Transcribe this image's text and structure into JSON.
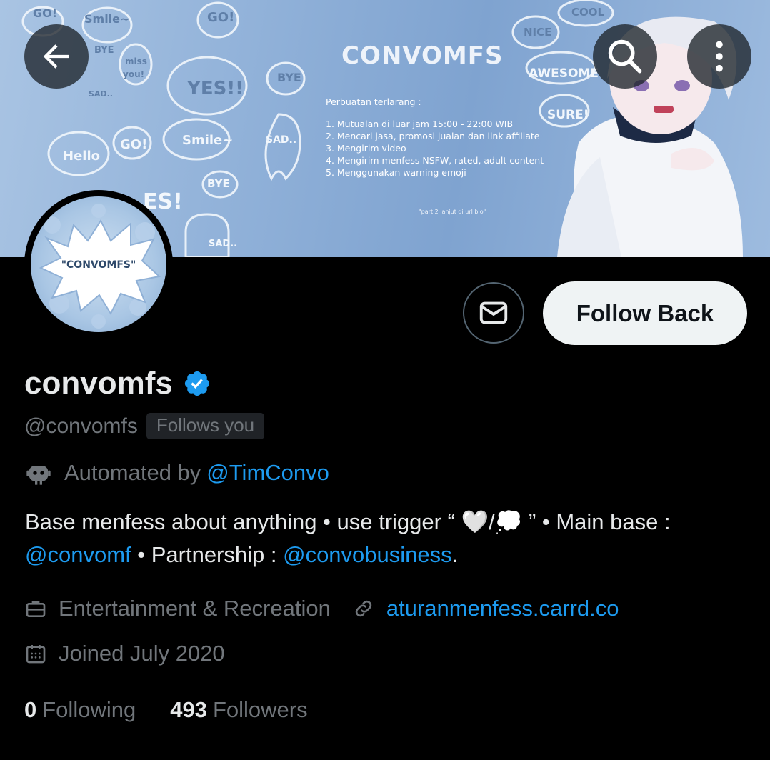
{
  "banner": {
    "title": "CONVOMFS",
    "rules_title": "Perbuatan terlarang :",
    "rules": [
      "1. Mutualan di luar jam 15:00 - 22:00 WIB",
      "2. Mencari jasa, promosi jualan dan link affiliate",
      "3. Mengirim video",
      "4. Mengirim menfess NSFW, rated, adult content",
      "5. Menggunakan warning emoji"
    ],
    "footnote": "\"part 2 lanjut di url bio\"",
    "doodle_words": [
      "Hello",
      "GO!",
      "Smile~",
      "BYE",
      "miss you!",
      "SAD..",
      "YES!!",
      "NICE",
      "AWESOME",
      "SURE!",
      "COOL"
    ]
  },
  "avatar": {
    "text": "\"CONVOMFS\""
  },
  "top_bar": {
    "back_icon": "arrow-left-icon",
    "search_icon": "search-icon",
    "more_icon": "more-vertical-icon"
  },
  "actions": {
    "message_icon": "envelope-icon",
    "follow_label": "Follow Back"
  },
  "profile": {
    "display_name": "convomfs",
    "handle": "@convomfs",
    "follows_you": "Follows you",
    "automated_prefix": "Automated by",
    "automated_by": "@TimConvo",
    "bio_part1": "Base menfess about anything • use trigger “ 🤍/💭 ” • Main base : ",
    "bio_link1": "@convomf",
    "bio_part2": " • Partnership : ",
    "bio_link2": "@convobusiness",
    "bio_part3": ".",
    "category": "Entertainment & Recreation",
    "website": "aturanmenfess.carrd.co",
    "joined": "Joined July 2020"
  },
  "stats": {
    "following_count": "0",
    "following_label": "Following",
    "followers_count": "493",
    "followers_label": "Followers"
  },
  "colors": {
    "background": "#000000",
    "text_primary": "#e7e9ea",
    "text_secondary": "#71767b",
    "link": "#1d9bf0",
    "verified_badge": "#1d9bf0",
    "follow_button_bg": "#eff3f4"
  }
}
